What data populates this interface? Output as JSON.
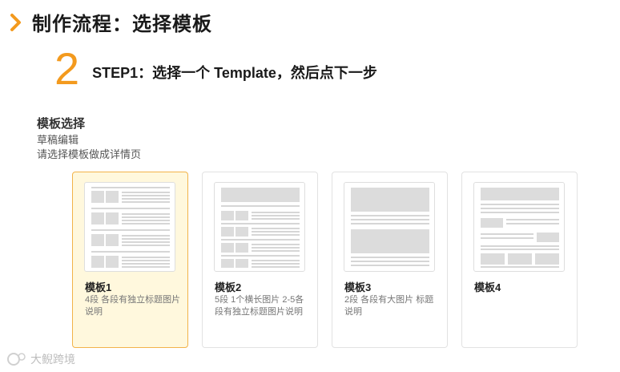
{
  "page_title": "制作流程：选择模板",
  "step": {
    "number": "2",
    "text": "STEP1：选择一个 Template，然后点下一步"
  },
  "section": {
    "title": "模板选择",
    "line1": "草稿编辑",
    "line2": "请选择模板做成详情页"
  },
  "templates": [
    {
      "name": "模板1",
      "description": "4段 各段有独立标题图片说明",
      "selected": true
    },
    {
      "name": "模板2",
      "description": "5段 1个横长图片 2-5各段有独立标题图片说明",
      "selected": false
    },
    {
      "name": "模板3",
      "description": "2段 各段有大图片 标题说明",
      "selected": false
    },
    {
      "name": "模板4",
      "description": "",
      "selected": false
    }
  ],
  "watermark": {
    "text": "大鲵跨境"
  },
  "colors": {
    "accent": "#f39a1e",
    "selected_bg": "#fff8dd",
    "selected_border": "#f2b34a",
    "placeholder": "#dcdcdc"
  },
  "icons": {
    "header": "chevron-right-icon",
    "watermark": "logo-icon"
  }
}
